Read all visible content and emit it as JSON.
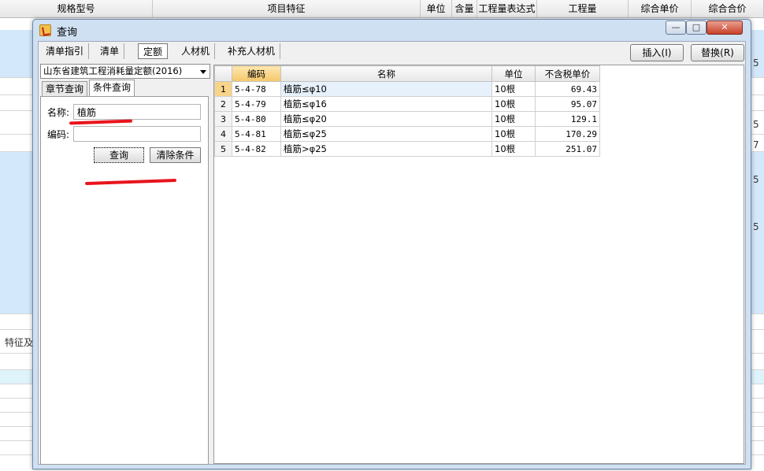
{
  "background_sheet": {
    "headers": [
      "规格型号",
      "项目特征",
      "单位",
      "含量",
      "工程量表达式",
      "工程量",
      "综合单价",
      "综合合价"
    ],
    "left_fragments": [
      "特征及"
    ],
    "right_fragments": [
      "5",
      "5",
      "7",
      "5",
      "5"
    ]
  },
  "dialog": {
    "title": "查询",
    "window_buttons": {
      "minimize": "—",
      "maximize": "□",
      "close": "✕"
    },
    "tabs": [
      {
        "label": "清单指引",
        "active": false
      },
      {
        "label": "清单",
        "active": false
      },
      {
        "label": "定额",
        "active": true
      },
      {
        "label": "人材机",
        "active": false
      },
      {
        "label": "补充人材机",
        "active": false
      }
    ],
    "insert_label": "插入(I)",
    "replace_label": "替换(R)",
    "library_select": "山东省建筑工程消耗量定额(2016)",
    "sub_tabs": [
      {
        "label": "章节查询",
        "active": false
      },
      {
        "label": "条件查询",
        "active": true
      }
    ],
    "form": {
      "name_label": "名称:",
      "name_value": "植筋",
      "code_label": "编码:",
      "code_value": "",
      "query_button": "查询",
      "clear_button": "清除条件"
    },
    "grid": {
      "columns": [
        "编码",
        "名称",
        "单位",
        "不含税单价"
      ],
      "rows": [
        {
          "no": "1",
          "code": "5-4-78",
          "name": "植筋≤φ10",
          "unit": "10根",
          "price": "69.43"
        },
        {
          "no": "2",
          "code": "5-4-79",
          "name": "植筋≤φ16",
          "unit": "10根",
          "price": "95.07"
        },
        {
          "no": "3",
          "code": "5-4-80",
          "name": "植筋≤φ20",
          "unit": "10根",
          "price": "129.1"
        },
        {
          "no": "4",
          "code": "5-4-81",
          "name": "植筋≤φ25",
          "unit": "10根",
          "price": "170.29"
        },
        {
          "no": "5",
          "code": "5-4-82",
          "name": "植筋>φ25",
          "unit": "10根",
          "price": "251.07"
        }
      ]
    }
  },
  "colors": {
    "dialog_frame": "#cfe0f2",
    "highlight_band": "#d4e8fb",
    "selected_header": "#f5c767",
    "annotation_red": "#e8141d"
  }
}
